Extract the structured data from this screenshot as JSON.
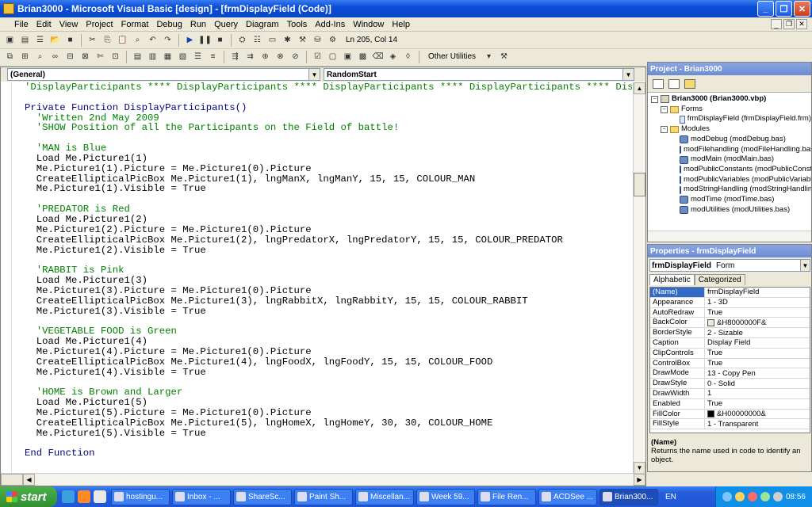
{
  "window": {
    "title": "Brian3000 - Microsoft Visual Basic [design] - [frmDisplayField (Code)]"
  },
  "menu": [
    "File",
    "Edit",
    "View",
    "Project",
    "Format",
    "Debug",
    "Run",
    "Query",
    "Diagram",
    "Tools",
    "Add-Ins",
    "Window",
    "Help"
  ],
  "toolbar": {
    "position": "Ln 205, Col 14",
    "other_utilities": "Other Utilities"
  },
  "editor": {
    "object_combo": "(General)",
    "proc_combo": "RandomStart",
    "lines": [
      {
        "t": "'DisplayParticipants **** DisplayParticipants **** DisplayParticipants **** DisplayParticipants **** Displa",
        "c": "cmt"
      },
      {
        "t": "",
        "c": ""
      },
      {
        "t": "Private Function DisplayParticipants()",
        "c": "kw"
      },
      {
        "t": "  'Written 2nd May 2009",
        "c": "cmt"
      },
      {
        "t": "  'SHOW Position of all the Participants on the Field of battle!",
        "c": "cmt"
      },
      {
        "t": "",
        "c": ""
      },
      {
        "t": "  'MAN is Blue",
        "c": "cmt"
      },
      {
        "t": "  Load Me.Picture1(1)",
        "c": ""
      },
      {
        "t": "  Me.Picture1(1).Picture = Me.Picture1(0).Picture",
        "c": ""
      },
      {
        "t": "  CreateEllipticalPicBox Me.Picture1(1), lngManX, lngManY, 15, 15, COLOUR_MAN",
        "c": ""
      },
      {
        "t": "  Me.Picture1(1).Visible = True",
        "c": ""
      },
      {
        "t": "",
        "c": ""
      },
      {
        "t": "  'PREDATOR is Red",
        "c": "cmt"
      },
      {
        "t": "  Load Me.Picture1(2)",
        "c": ""
      },
      {
        "t": "  Me.Picture1(2).Picture = Me.Picture1(0).Picture",
        "c": ""
      },
      {
        "t": "  CreateEllipticalPicBox Me.Picture1(2), lngPredatorX, lngPredatorY, 15, 15, COLOUR_PREDATOR",
        "c": ""
      },
      {
        "t": "  Me.Picture1(2).Visible = True",
        "c": ""
      },
      {
        "t": "",
        "c": ""
      },
      {
        "t": "  'RABBIT is Pink",
        "c": "cmt"
      },
      {
        "t": "  Load Me.Picture1(3)",
        "c": ""
      },
      {
        "t": "  Me.Picture1(3).Picture = Me.Picture1(0).Picture",
        "c": ""
      },
      {
        "t": "  CreateEllipticalPicBox Me.Picture1(3), lngRabbitX, lngRabbitY, 15, 15, COLOUR_RABBIT",
        "c": ""
      },
      {
        "t": "  Me.Picture1(3).Visible = True",
        "c": ""
      },
      {
        "t": "",
        "c": ""
      },
      {
        "t": "  'VEGETABLE FOOD is Green",
        "c": "cmt"
      },
      {
        "t": "  Load Me.Picture1(4)",
        "c": ""
      },
      {
        "t": "  Me.Picture1(4).Picture = Me.Picture1(0).Picture",
        "c": ""
      },
      {
        "t": "  CreateEllipticalPicBox Me.Picture1(4), lngFoodX, lngFoodY, 15, 15, COLOUR_FOOD",
        "c": ""
      },
      {
        "t": "  Me.Picture1(4).Visible = True",
        "c": ""
      },
      {
        "t": "",
        "c": ""
      },
      {
        "t": "  'HOME is Brown and Larger",
        "c": "cmt"
      },
      {
        "t": "  Load Me.Picture1(5)",
        "c": ""
      },
      {
        "t": "  Me.Picture1(5).Picture = Me.Picture1(0).Picture",
        "c": ""
      },
      {
        "t": "  CreateEllipticalPicBox Me.Picture1(5), lngHomeX, lngHomeY, 30, 30, COLOUR_HOME",
        "c": ""
      },
      {
        "t": "  Me.Picture1(5).Visible = True",
        "c": ""
      },
      {
        "t": "",
        "c": ""
      },
      {
        "t": "End Function",
        "c": "kw"
      }
    ]
  },
  "project": {
    "title": "Project - Brian3000",
    "root": "Brian3000 (Brian3000.vbp)",
    "forms_label": "Forms",
    "forms": [
      "frmDisplayField (frmDisplayField.frm)"
    ],
    "modules_label": "Modules",
    "modules": [
      "modDebug (modDebug.bas)",
      "modFilehandling (modFileHandling.bas)",
      "modMain (modMain.bas)",
      "modPublicConstants (modPublicConstants.bas)",
      "modPublicVariables (modPublicVariables.bas)",
      "modStringHandling (modStringHandling.bas)",
      "modTime (modTime.bas)",
      "modUtilities (modUtilities.bas)"
    ]
  },
  "properties": {
    "title": "Properties - frmDisplayField",
    "object_name": "frmDisplayField",
    "object_type": "Form",
    "tabs": [
      "Alphabetic",
      "Categorized"
    ],
    "rows": [
      {
        "k": "(Name)",
        "v": "frmDisplayField",
        "sel": true
      },
      {
        "k": "Appearance",
        "v": "1 - 3D"
      },
      {
        "k": "AutoRedraw",
        "v": "True"
      },
      {
        "k": "BackColor",
        "v": "&H8000000F&",
        "swatch": "#ece9d8"
      },
      {
        "k": "BorderStyle",
        "v": "2 - Sizable"
      },
      {
        "k": "Caption",
        "v": "Display Field"
      },
      {
        "k": "ClipControls",
        "v": "True"
      },
      {
        "k": "ControlBox",
        "v": "True"
      },
      {
        "k": "DrawMode",
        "v": "13 - Copy Pen"
      },
      {
        "k": "DrawStyle",
        "v": "0 - Solid"
      },
      {
        "k": "DrawWidth",
        "v": "1"
      },
      {
        "k": "Enabled",
        "v": "True"
      },
      {
        "k": "FillColor",
        "v": "&H00000000&",
        "swatch": "#000000"
      },
      {
        "k": "FillStyle",
        "v": "1 - Transparent"
      }
    ],
    "desc_title": "(Name)",
    "desc_text": "Returns the name used in code to identify an object."
  },
  "taskbar": {
    "start": "start",
    "tasks": [
      "hostingu...",
      "Inbox - ...",
      "ShareSc...",
      "Paint Sh...",
      "Miscellan...",
      "Week 59...",
      "File Ren...",
      "ACDSee ...",
      "Brian300..."
    ],
    "lang": "EN",
    "clock": "08:56"
  }
}
